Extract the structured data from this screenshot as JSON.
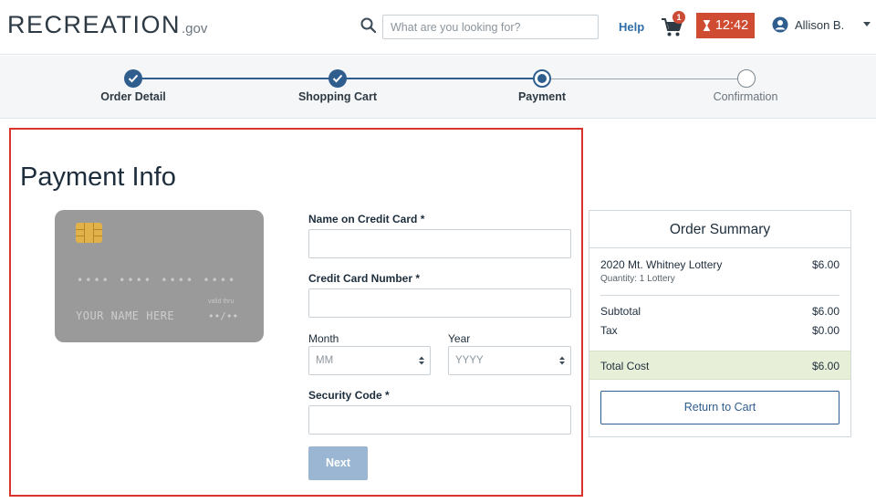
{
  "header": {
    "logo_main": "RECREATION",
    "logo_suffix": ".gov",
    "search_placeholder": "What are you looking for?",
    "help_label": "Help",
    "cart_count": "1",
    "timer": "12:42",
    "user_name": "Allison B.",
    "icons": [
      "search-icon",
      "cart-icon",
      "hourglass-icon",
      "user-avatar-icon",
      "chevron-down-icon"
    ]
  },
  "steps": [
    {
      "label": "Order Detail",
      "state": "done"
    },
    {
      "label": "Shopping Cart",
      "state": "done"
    },
    {
      "label": "Payment",
      "state": "current"
    },
    {
      "label": "Confirmation",
      "state": "todo"
    }
  ],
  "payment": {
    "title": "Payment Info",
    "card": {
      "number_mask": "•••• •••• •••• ••••",
      "name_placeholder": "YOUR NAME HERE",
      "valid_thru": "valid thru",
      "expiry_mask": "••/••"
    },
    "name_label": "Name on Credit Card *",
    "number_label": "Credit Card Number *",
    "month_label": "Month",
    "month_value": "MM",
    "year_label": "Year",
    "year_value": "YYYY",
    "security_label": "Security Code *",
    "next_label": "Next"
  },
  "summary": {
    "title": "Order Summary",
    "item_name": "2020 Mt. Whitney Lottery",
    "item_price": "$6.00",
    "item_quantity": "Quantity: 1 Lottery",
    "subtotal_label": "Subtotal",
    "subtotal_value": "$6.00",
    "tax_label": "Tax",
    "tax_value": "$0.00",
    "total_label": "Total Cost",
    "total_value": "$6.00",
    "return_label": "Return to Cart"
  },
  "colors": {
    "brand_blue": "#2f5d8e",
    "timer_red": "#cf4b32",
    "highlight_red": "#d9342b",
    "total_band": "#e8efd9",
    "next_disabled": "#9bb6d2"
  }
}
